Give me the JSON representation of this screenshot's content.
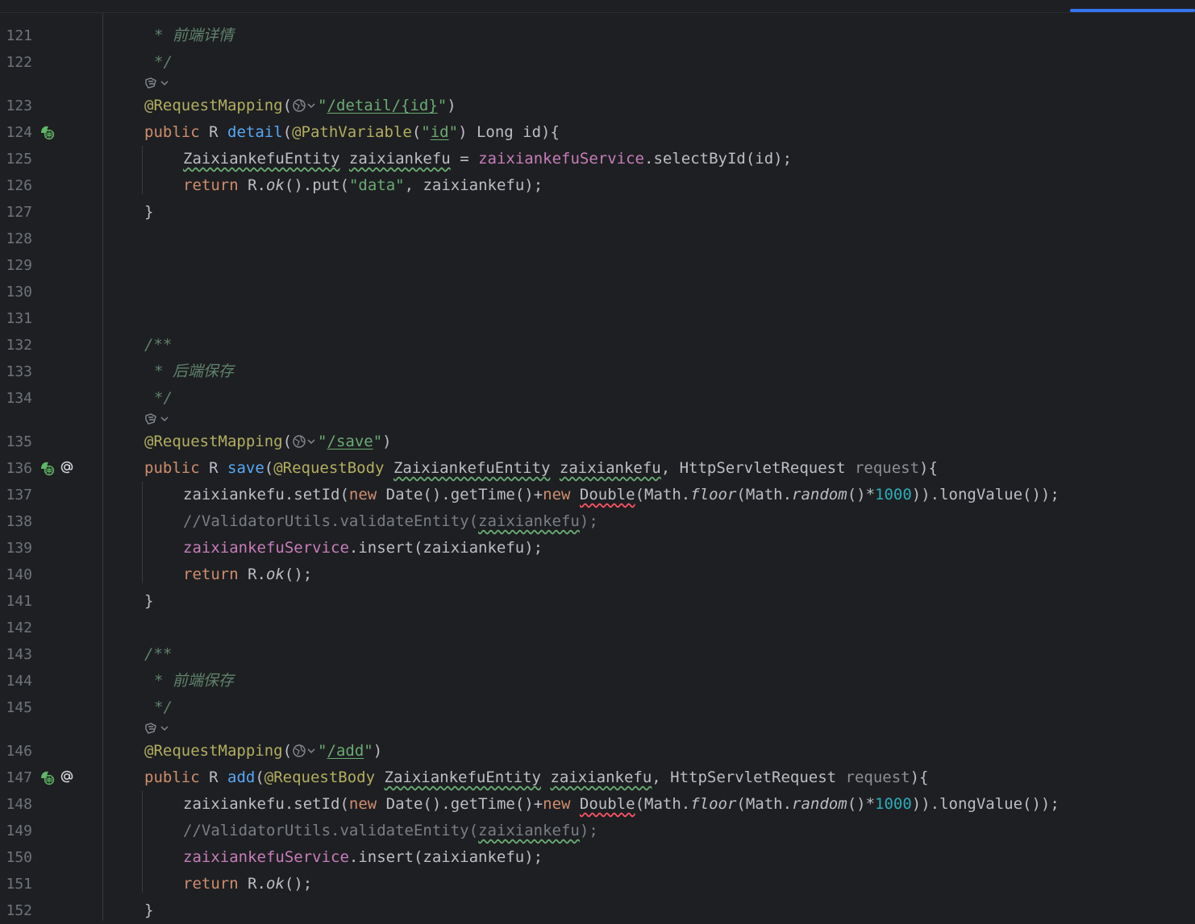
{
  "line_numbers": [
    "121",
    "122",
    "123",
    "124",
    "125",
    "126",
    "127",
    "128",
    "129",
    "130",
    "131",
    "132",
    "133",
    "134",
    "135",
    "136",
    "137",
    "138",
    "139",
    "140",
    "141",
    "142",
    "143",
    "144",
    "145",
    "146",
    "147",
    "148",
    "149",
    "150",
    "151",
    "152"
  ],
  "code": {
    "doc1_line": "* 前端详情",
    "doc_end": "*/",
    "doc_start": "/**",
    "kw_public": "public",
    "kw_return": "return",
    "kw_new": "new",
    "type_R": "R",
    "annot_request_mapping": "@RequestMapping",
    "annot_path_variable": "@PathVariable",
    "annot_request_body": "@RequestBody",
    "paren_open": "(",
    "paren_close": ")",
    "quote": "\"",
    "path_detail": "/detail/{id}",
    "path_save": "/save",
    "path_add": "/add",
    "fn_detail": "detail",
    "fn_save": "save",
    "fn_add": "add",
    "str_id": "id",
    "long_id": " Long id){",
    "entity_type": "ZaixiankefuEntity",
    "var_entity": "zaixiankefu",
    "assign": " = ",
    "service_field": "zaixiankefuService",
    "select_call": ".selectById(id);",
    "r_dot": "R.",
    "ok": "ok",
    "put_call": "().put(",
    "str_data": "\"data\"",
    "put_tail": ", zaixiankefu);",
    "brace_close": "}",
    "doc2_line": "* 后端保存",
    "doc3_line": "* 前端保存",
    "comma": ", ",
    "servlet_type": "HttpServletRequest ",
    "param_request": "request",
    "sig_tail": "){",
    "setid_head": "zaixiankefu.setId(",
    "date_call": " Date().getTime()+",
    "double_type": "Double",
    "math_dot": "(Math.",
    "floor": "floor",
    "random": "random",
    "times": "()*",
    "num_1000": "1000",
    "long_value": ")).longValue());",
    "validator_comment": "//ValidatorUtils.validateEntity(",
    "validator_arg": "zaixiankefu",
    "validator_end": ");",
    "insert_call": ".insert(zaixiankefu);",
    "ok_end": "();"
  },
  "icons": [
    "web-endpoint-icon",
    "at-sign-icon",
    "globe-dropdown-icon",
    "ai-hint-icon",
    "chevron-down-icon"
  ],
  "colors": {
    "background": "#1e1f22",
    "keyword": "#cf8e6d",
    "annotation": "#b3ae60",
    "string": "#6aab73",
    "function": "#56a8f5",
    "field": "#c77dbb",
    "number": "#2aacb8",
    "doc_comment": "#5f826b",
    "line_number": "#6f737a",
    "progress": "#3574f0"
  }
}
